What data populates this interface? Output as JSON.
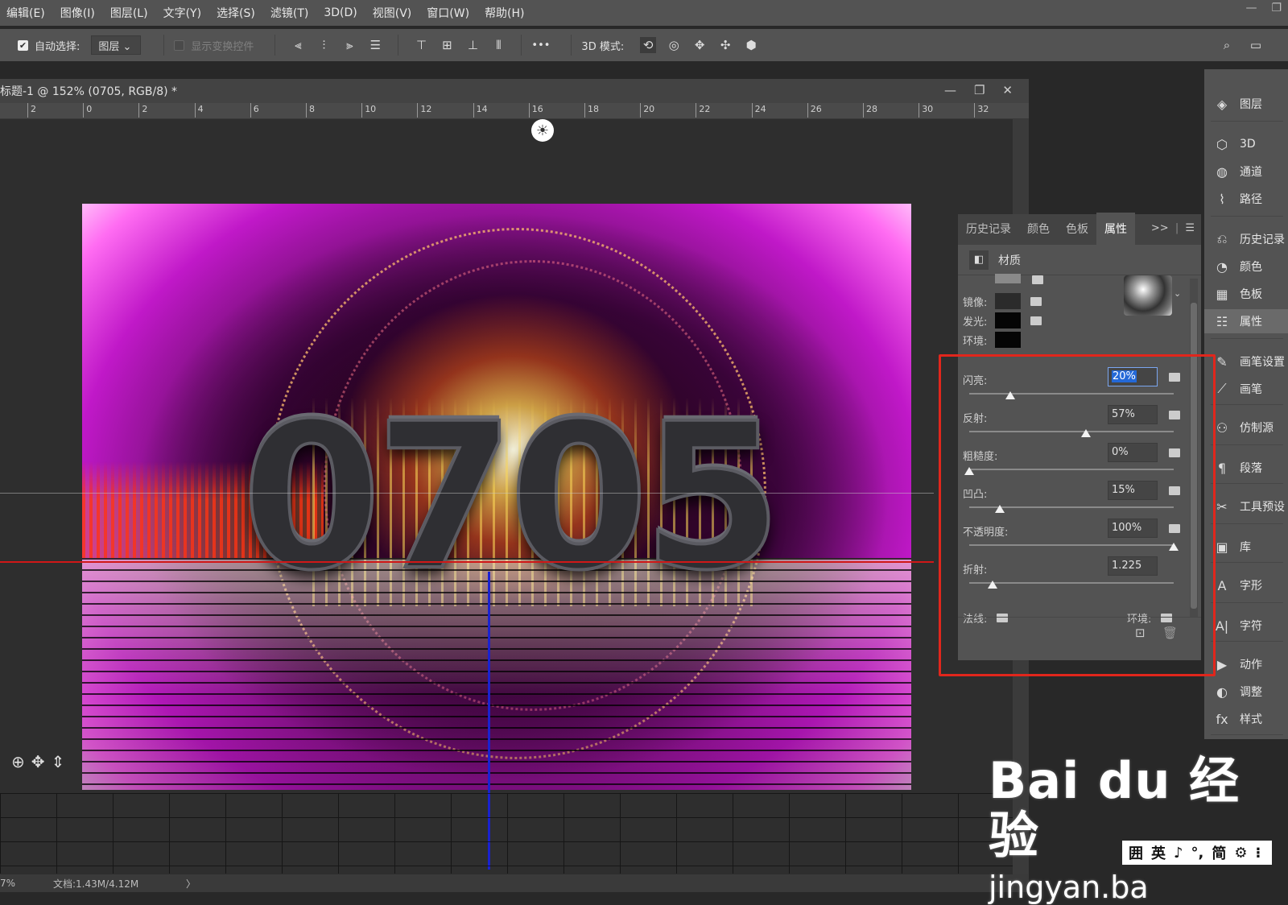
{
  "menubar": {
    "items": [
      "编辑(E)",
      "图像(I)",
      "图层(L)",
      "文字(Y)",
      "选择(S)",
      "滤镜(T)",
      "3D(D)",
      "视图(V)",
      "窗口(W)",
      "帮助(H)"
    ],
    "window_controls": [
      "—",
      "❐",
      ""
    ]
  },
  "options": {
    "auto_select_label": "自动选择:",
    "auto_select_value": "图层",
    "show_transform_label": "显示变换控件",
    "more": "•••",
    "mode3d_label": "3D 模式:"
  },
  "document": {
    "title": "标题-1 @ 152% (0705, RGB/8) *",
    "controls": [
      "—",
      "❐",
      "✕"
    ],
    "ruler_ticks": [
      "2",
      "0",
      "2",
      "4",
      "6",
      "8",
      "10",
      "12",
      "14",
      "16",
      "18",
      "20",
      "22",
      "24",
      "26",
      "28",
      "30",
      "32"
    ],
    "canvas_text": "0705"
  },
  "status": {
    "zoom": "7%",
    "doc_info": "文档:1.43M/4.12M",
    "arrow": "〉"
  },
  "dock": {
    "items": [
      {
        "label": "图层",
        "icon": "layers-icon",
        "glyph": "◈"
      },
      {
        "label": "3D",
        "icon": "cube-icon",
        "glyph": "⬡"
      },
      {
        "label": "通道",
        "icon": "channels-icon",
        "glyph": "◍"
      },
      {
        "label": "路径",
        "icon": "paths-icon",
        "glyph": "⌇"
      },
      {
        "label": "历史记录",
        "icon": "history-icon",
        "glyph": "⎌"
      },
      {
        "label": "颜色",
        "icon": "color-palette-icon",
        "glyph": "◔"
      },
      {
        "label": "色板",
        "icon": "swatches-icon",
        "glyph": "▦"
      },
      {
        "label": "属性",
        "icon": "properties-icon",
        "glyph": "☷"
      },
      {
        "label": "画笔设置",
        "icon": "brush-settings-icon",
        "glyph": "✎"
      },
      {
        "label": "画笔",
        "icon": "brush-icon",
        "glyph": "⟋"
      },
      {
        "label": "仿制源",
        "icon": "clone-source-icon",
        "glyph": "⚇"
      },
      {
        "label": "段落",
        "icon": "paragraph-icon",
        "glyph": "¶"
      },
      {
        "label": "工具预设",
        "icon": "tool-presets-icon",
        "glyph": "✂"
      },
      {
        "label": "库",
        "icon": "library-icon",
        "glyph": "▣"
      },
      {
        "label": "字形",
        "icon": "glyphs-icon",
        "glyph": "A"
      },
      {
        "label": "字符",
        "icon": "character-icon",
        "glyph": "A|"
      },
      {
        "label": "动作",
        "icon": "play-icon",
        "glyph": "▶"
      },
      {
        "label": "调整",
        "icon": "adjustments-icon",
        "glyph": "◐"
      },
      {
        "label": "样式",
        "icon": "styles-icon",
        "glyph": "fx"
      }
    ]
  },
  "properties": {
    "tabs": [
      "历史记录",
      "颜色",
      "色板",
      "属性"
    ],
    "active_tab": "属性",
    "section": "材质",
    "swatches": [
      {
        "label": "镜像:",
        "color": "#2b2b2b"
      },
      {
        "label": "发光:",
        "color": "#050505"
      },
      {
        "label": "环境:",
        "color": "#050505"
      }
    ],
    "params": [
      {
        "label": "闪亮:",
        "value": "20%",
        "level": 0.2,
        "selected": true,
        "folder": true
      },
      {
        "label": "反射:",
        "value": "57%",
        "level": 0.57,
        "selected": false,
        "folder": true
      },
      {
        "label": "粗糙度:",
        "value": "0%",
        "level": 0.0,
        "selected": false,
        "folder": true
      },
      {
        "label": "凹凸:",
        "value": "15%",
        "level": 0.15,
        "selected": false,
        "folder": true
      },
      {
        "label": "不透明度:",
        "value": "100%",
        "level": 1.0,
        "selected": false,
        "folder": true
      },
      {
        "label": "折射:",
        "value": "1.225",
        "level": 0.1125,
        "selected": false,
        "folder": false
      }
    ],
    "normal_label": "法线:",
    "env_label": "环境:"
  },
  "watermark": {
    "line1": "Bai du 经验",
    "line2": "jingyan.ba",
    "ime": [
      "囲",
      "英",
      "♪",
      "°,",
      "简",
      "⚙",
      "⁝"
    ]
  }
}
